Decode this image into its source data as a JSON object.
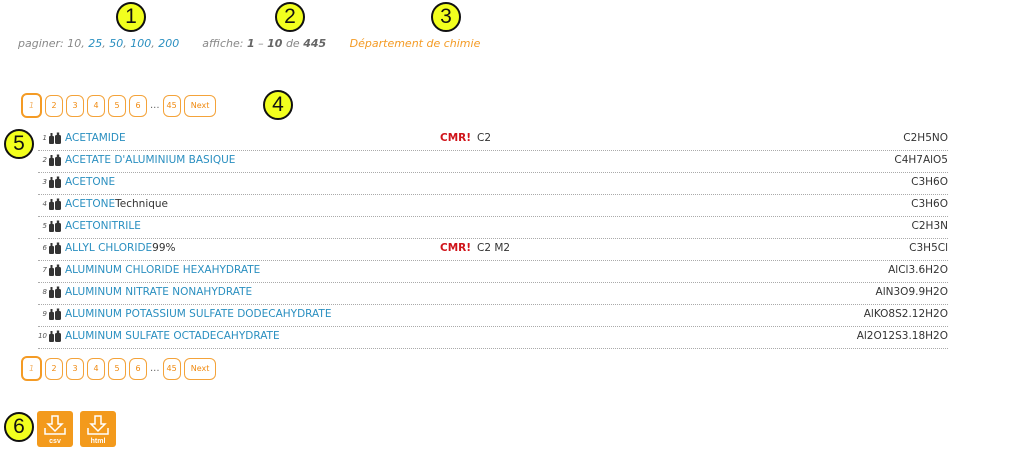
{
  "markers": [
    "1",
    "2",
    "3",
    "4",
    "5",
    "6"
  ],
  "paging": {
    "label": "paginer:",
    "sizes": [
      "10",
      "25",
      "50",
      "100",
      "200"
    ]
  },
  "display": {
    "label": "affiche:",
    "from": "1",
    "dash": "–",
    "to": "10",
    "of": "de",
    "total": "445"
  },
  "department": "Département de chimie",
  "pagination": {
    "pages": [
      "1",
      "2",
      "3",
      "4",
      "5",
      "6"
    ],
    "ellipsis": "...",
    "last": "45",
    "next": "Next"
  },
  "rows": [
    {
      "num": "1",
      "name": "ACETAMIDE",
      "extra": "",
      "cmr": "CMR!",
      "code": "C2",
      "formula": "C2H5NO"
    },
    {
      "num": "2",
      "name": "ACETATE D'ALUMINIUM BASIQUE",
      "extra": "",
      "cmr": "",
      "code": "",
      "formula": "C4H7AlO5"
    },
    {
      "num": "3",
      "name": "ACETONE",
      "extra": "",
      "cmr": "",
      "code": "",
      "formula": "C3H6O"
    },
    {
      "num": "4",
      "name": "ACETONE",
      "extra": "Technique",
      "cmr": "",
      "code": "",
      "formula": "C3H6O"
    },
    {
      "num": "5",
      "name": "ACETONITRILE",
      "extra": "",
      "cmr": "",
      "code": "",
      "formula": "C2H3N"
    },
    {
      "num": "6",
      "name": "ALLYL CHLORIDE",
      "extra": "99%",
      "cmr": "CMR!",
      "code": "C2 M2",
      "formula": "C3H5Cl"
    },
    {
      "num": "7",
      "name": "ALUMINUM CHLORIDE HEXAHYDRATE",
      "extra": "",
      "cmr": "",
      "code": "",
      "formula": "AlCl3.6H2O"
    },
    {
      "num": "8",
      "name": "ALUMINUM NITRATE NONAHYDRATE",
      "extra": "",
      "cmr": "",
      "code": "",
      "formula": "AlN3O9.9H2O"
    },
    {
      "num": "9",
      "name": "ALUMINUM POTASSIUM SULFATE DODECAHYDRATE",
      "extra": "",
      "cmr": "",
      "code": "",
      "formula": "AlKO8S2.12H2O"
    },
    {
      "num": "10",
      "name": "ALUMINUM SULFATE OCTADECAHYDRATE",
      "extra": "",
      "cmr": "",
      "code": "",
      "formula": "Al2O12S3.18H2O"
    }
  ],
  "downloads": [
    {
      "label": "csv",
      "icon": "download-csv-icon"
    },
    {
      "label": "html",
      "icon": "download-html-icon"
    }
  ],
  "colors": {
    "accent": "#f39a1c",
    "link": "#2a8fc0",
    "cmr": "#d0141a",
    "marker": "#f2ff1e"
  }
}
